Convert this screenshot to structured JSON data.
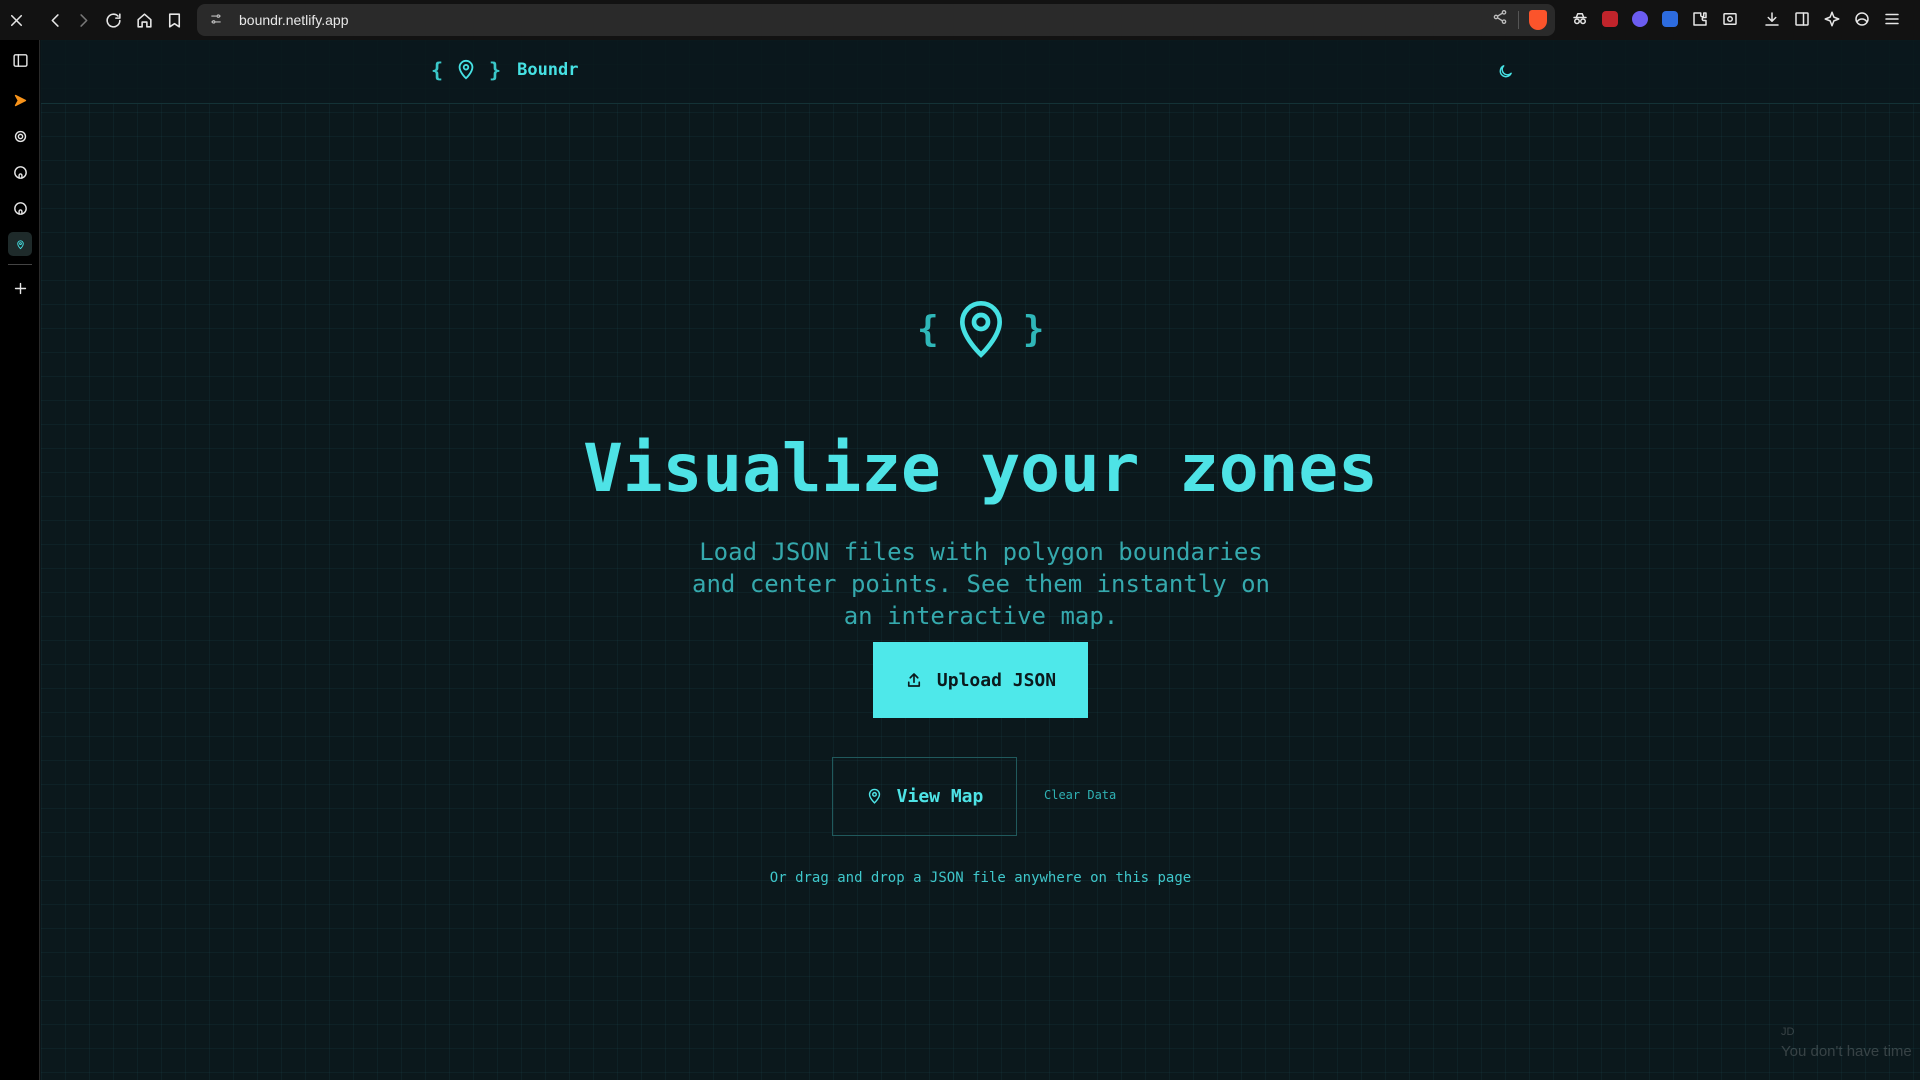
{
  "browser": {
    "url": "boundr.netlify.app",
    "close_icon": "close-icon",
    "icons": [
      "back-icon",
      "forward-icon",
      "reload-icon",
      "home-icon",
      "bookmark-icon",
      "site-info-icon",
      "share-icon",
      "brave-shields-icon"
    ],
    "extensions": [
      "incognito-ext-icon",
      "ublock-icon",
      "ext-blue-icon",
      "ext-purple-icon",
      "extensions-icon",
      "screenshot-icon",
      "download-icon",
      "sidebar-toggle-icon",
      "leo-ai-icon",
      "profile-icon",
      "menu-icon"
    ]
  },
  "sidebar": {
    "items": [
      "sidebar-panel-icon",
      "brave-rewards-icon",
      "chatgpt-icon",
      "github-icon",
      "github-icon-2",
      "boundr-tab-icon",
      "add-icon"
    ]
  },
  "header": {
    "brace_open": "{",
    "brace_close": "}",
    "brand": "Boundr"
  },
  "hero": {
    "brace_open": "{",
    "brace_close": "}",
    "title": "Visualize your zones",
    "subtitle": "Load JSON files with polygon boundaries and center points. See them instantly on an interactive map.",
    "upload_label": "Upload JSON",
    "view_map_label": "View Map",
    "clear_label": "Clear Data",
    "drop_hint": "Or drag and drop a JSON file anywhere on this page"
  },
  "watermark": {
    "line1": "JD",
    "line2": "You don't have time"
  },
  "colors": {
    "accent": "#4ee8ea",
    "background": "#0b181c",
    "muted_text": "#35a9ad"
  }
}
